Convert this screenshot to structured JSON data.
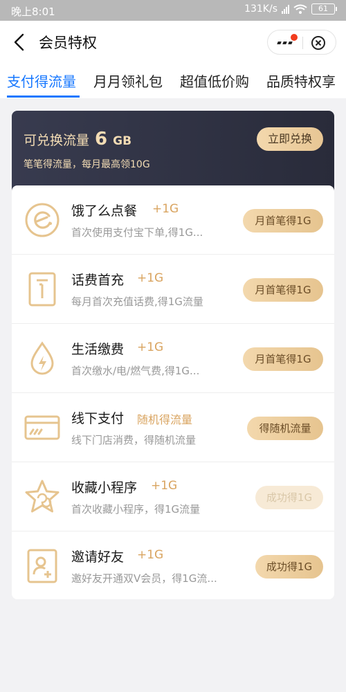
{
  "status_bar": {
    "time": "晚上8:01",
    "network_speed": "131K/s",
    "network_type": "HD",
    "battery": "61"
  },
  "nav": {
    "title": "会员特权",
    "icons": [
      "back-arrow-icon",
      "more-dots-icon",
      "close-target-icon"
    ],
    "badge_color": "#f23c1e"
  },
  "tabs": [
    {
      "label": "支付得流量",
      "active": true
    },
    {
      "label": "月月领礼包",
      "active": false
    },
    {
      "label": "超值低价购",
      "active": false
    },
    {
      "label": "品质特权享",
      "active": false
    }
  ],
  "header": {
    "title_prefix": "可兑换流量",
    "amount": "6",
    "unit": "GB",
    "subtitle": "笔笔得流量，每月最高领10G",
    "button": "立即兑换"
  },
  "items": [
    {
      "title": "饿了么点餐",
      "bonus": "+1G",
      "desc": "首次使用支付宝下单,得1G...",
      "button": "月首笔得1G",
      "disabled": false,
      "icon": "eleme-icon"
    },
    {
      "title": "话费首充",
      "bonus": "+1G",
      "desc": "每月首次充值话费,得1G流量",
      "button": "月首笔得1G",
      "disabled": false,
      "icon": "phone-icon"
    },
    {
      "title": "生活缴费",
      "bonus": "+1G",
      "desc": "首次缴水/电/燃气费,得1G...",
      "button": "月首笔得1G",
      "disabled": false,
      "icon": "utility-drop-icon"
    },
    {
      "title": "线下支付",
      "bonus": "随机得流量",
      "desc": "线下门店消费，得随机流量",
      "button": "得随机流量",
      "disabled": false,
      "icon": "card-icon"
    },
    {
      "title": "收藏小程序",
      "bonus": "+1G",
      "desc": "首次收藏小程序，得1G流量",
      "button": "成功得1G",
      "disabled": true,
      "icon": "star-miniapp-icon"
    },
    {
      "title": "邀请好友",
      "bonus": "+1G",
      "desc": "邀好友开通双V会员，得1G流...",
      "button": "成功得1G",
      "disabled": false,
      "icon": "invite-user-icon"
    }
  ],
  "colors": {
    "accent_blue": "#1677ff",
    "gold_text": "#d9a460",
    "header_bg": "#2f3142"
  }
}
